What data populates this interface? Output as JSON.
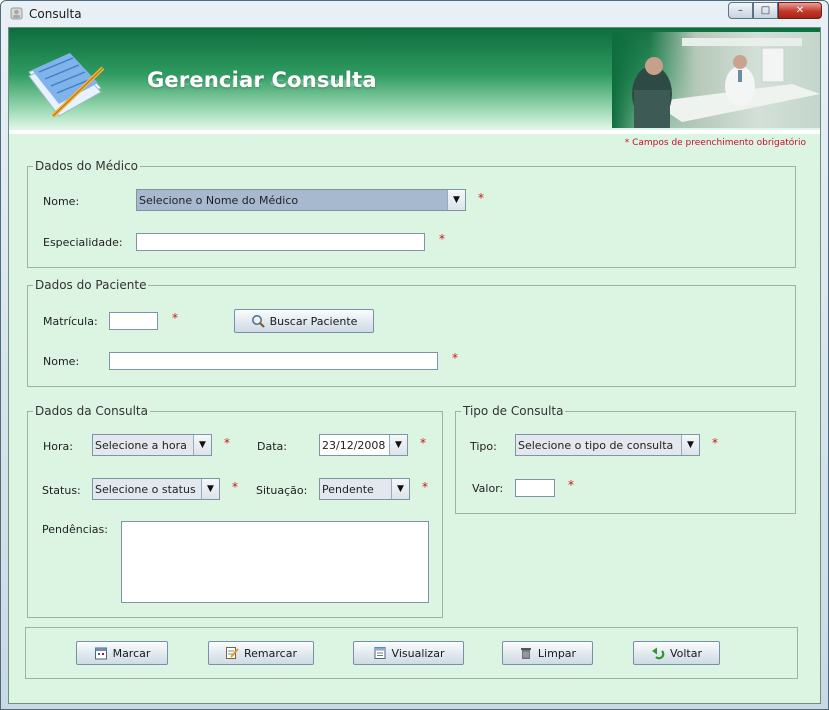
{
  "window": {
    "title": "Consulta",
    "controls": {
      "minimize": "–",
      "maximize": "□",
      "close": "✕"
    }
  },
  "banner": {
    "title": "Gerenciar Consulta"
  },
  "required_note": "* Campos de preenchimento obrigatório",
  "required_mark": "*",
  "medico": {
    "legend": "Dados do Médico",
    "nome_label": "Nome:",
    "nome_value": "Selecione o Nome do Médico",
    "especialidade_label": "Especialidade:"
  },
  "paciente": {
    "legend": "Dados do Paciente",
    "matricula_label": "Matrícula:",
    "buscar_button": "Buscar Paciente",
    "nome_label": "Nome:"
  },
  "consulta": {
    "legend": "Dados da Consulta",
    "hora_label": "Hora:",
    "hora_value": "Selecione a hora",
    "data_label": "Data:",
    "data_value": "23/12/2008",
    "status_label": "Status:",
    "status_value": "Selecione o status",
    "situacao_label": "Situação:",
    "situacao_value": "Pendente",
    "pendencias_label": "Pendências:"
  },
  "tipo": {
    "legend": "Tipo de Consulta",
    "tipo_label": "Tipo:",
    "tipo_value": "Selecione o tipo de consulta",
    "valor_label": "Valor:"
  },
  "actions": {
    "marcar": "Marcar",
    "remarcar": "Remarcar",
    "visualizar": "Visualizar",
    "limpar": "Limpar",
    "voltar": "Voltar"
  }
}
